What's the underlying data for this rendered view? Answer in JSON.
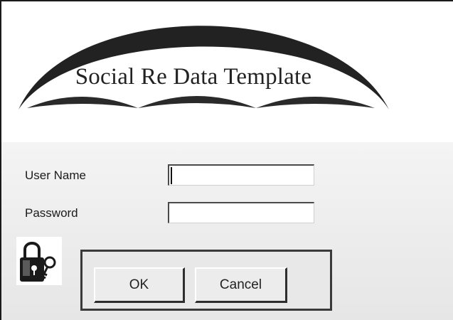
{
  "banner": {
    "title": "Social Re Data Template"
  },
  "form": {
    "username_label": "User Name",
    "username_value": "",
    "password_label": "Password",
    "password_value": ""
  },
  "buttons": {
    "ok_label": "OK",
    "cancel_label": "Cancel"
  },
  "icons": {
    "lock": "lock-with-key-icon"
  },
  "colors": {
    "window_border": "#1a1a1a",
    "panel_background": "#ececec",
    "banner_arc": "#222222"
  }
}
